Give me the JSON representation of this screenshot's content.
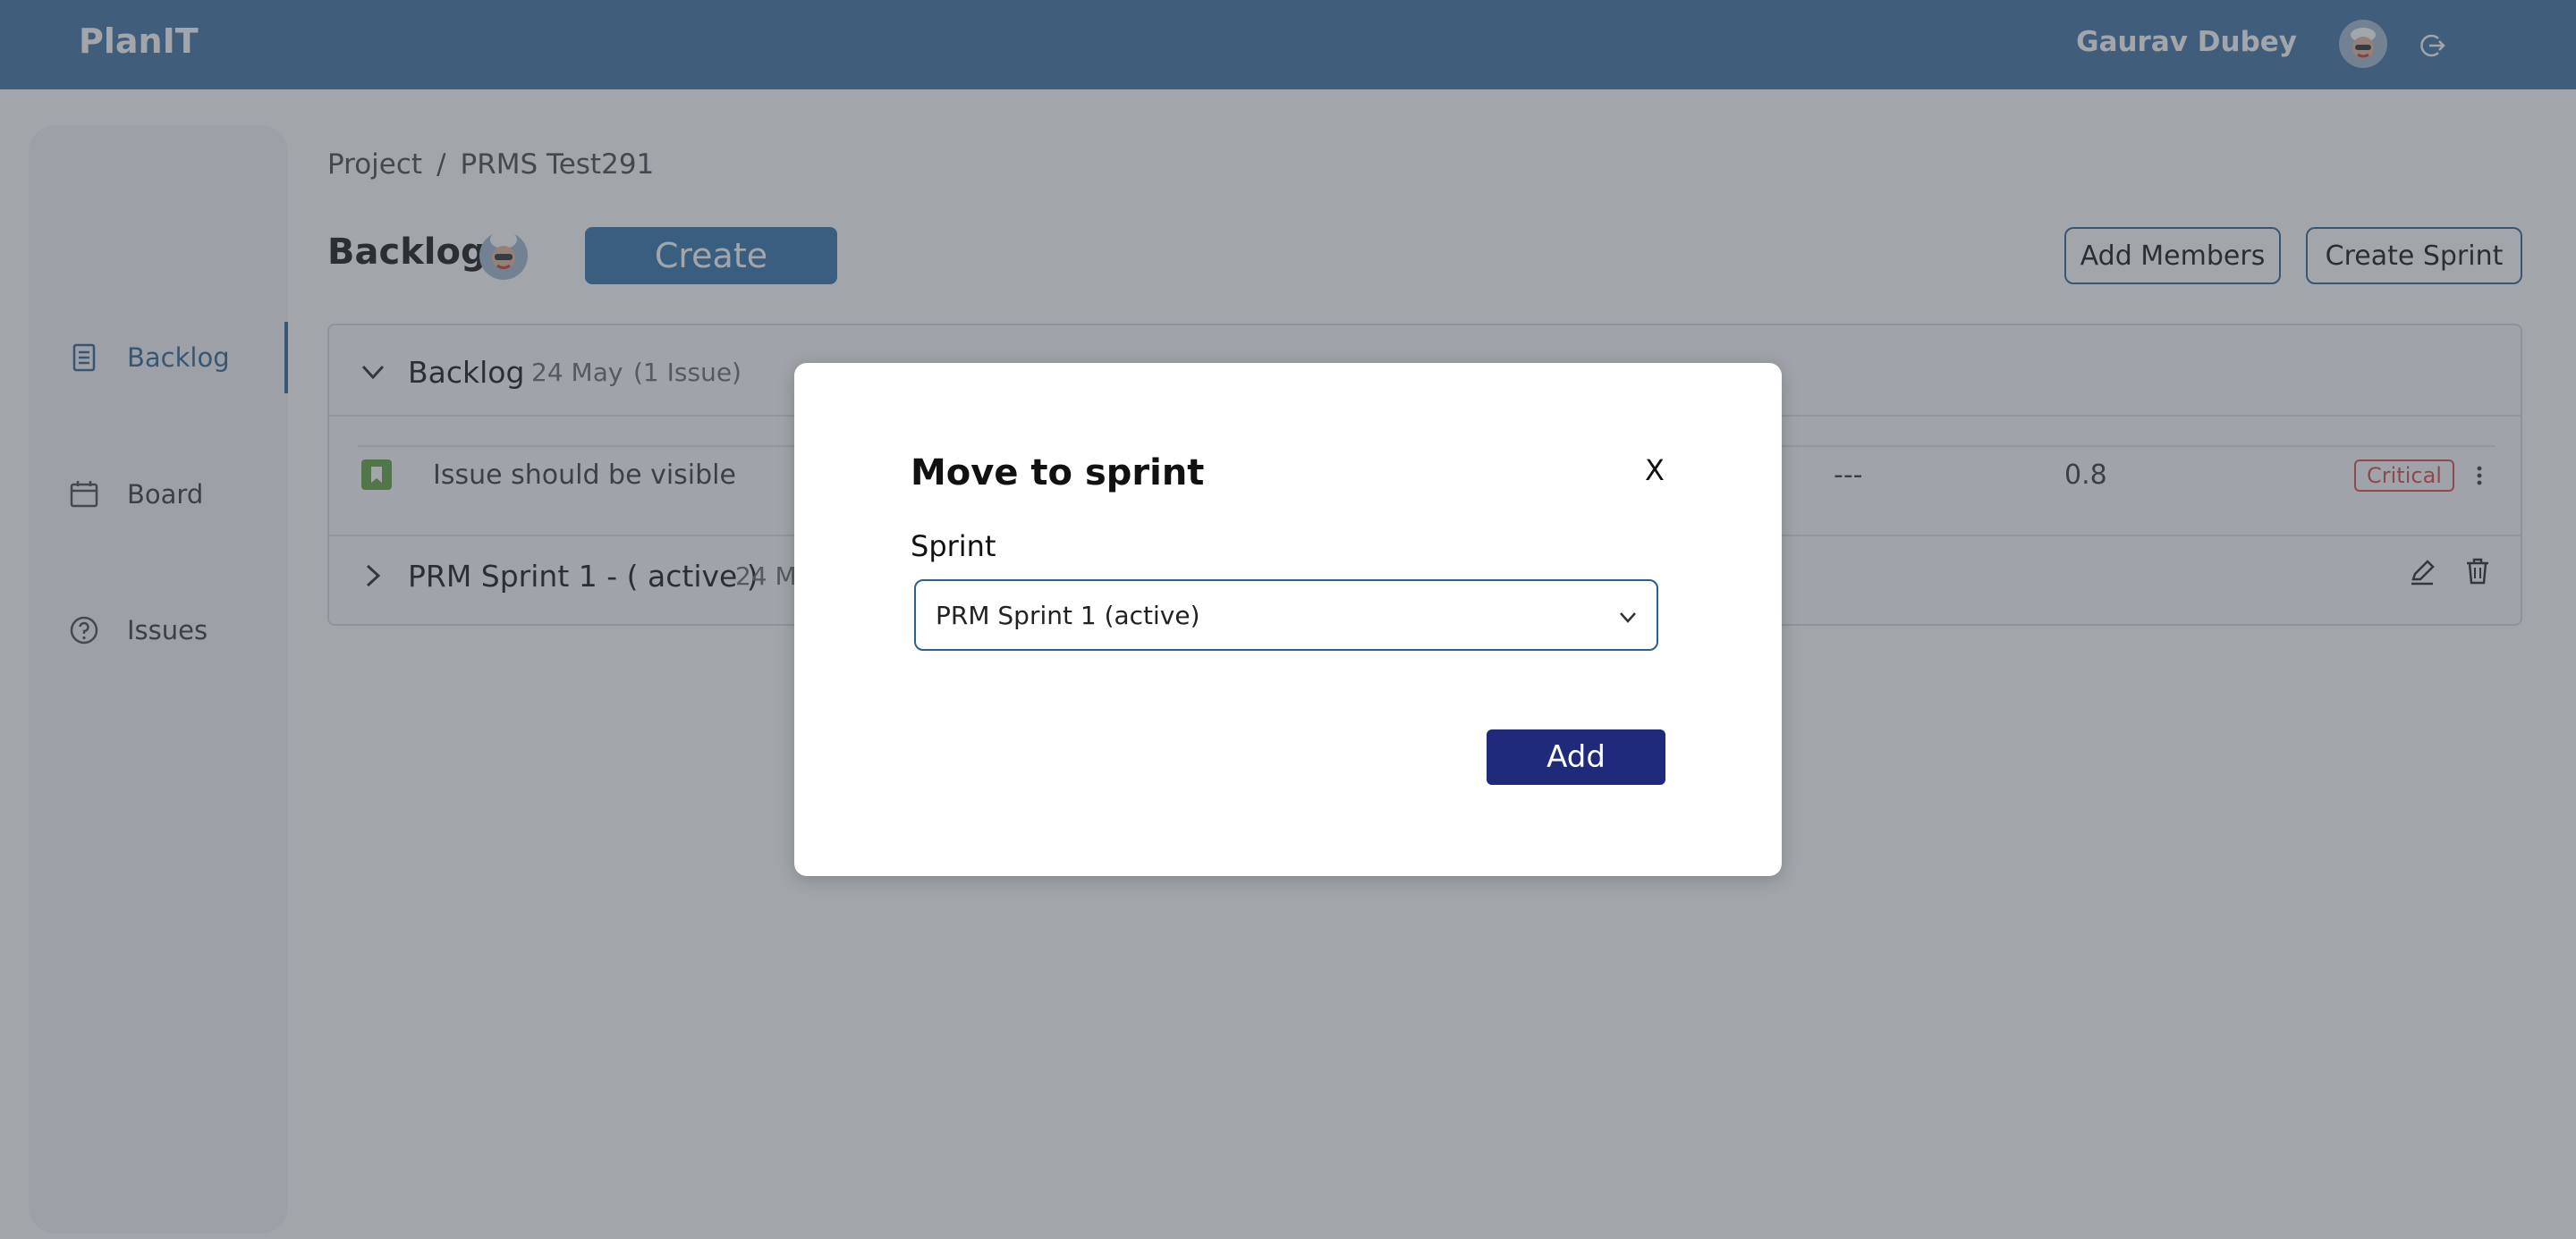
{
  "app": {
    "name": "PlanIT"
  },
  "user": {
    "name": "Gaurav Dubey"
  },
  "sidebar": {
    "items": [
      {
        "label": "Backlog",
        "icon": "list-icon"
      },
      {
        "label": "Board",
        "icon": "calendar-icon"
      },
      {
        "label": "Issues",
        "icon": "help-circle-icon"
      }
    ]
  },
  "breadcrumb": {
    "root": "Project",
    "separator": "/",
    "current": "PRMS Test291"
  },
  "page": {
    "title": "Backlog",
    "create_label": "Create",
    "add_members_label": "Add Members",
    "create_sprint_label": "Create Sprint"
  },
  "backlog_section": {
    "title": "Backlog",
    "date": "24 May",
    "count": "(1 Issue)",
    "issues": [
      {
        "title": "Issue should be visible",
        "assignee": "---",
        "points": "0.8",
        "priority": "Critical"
      }
    ]
  },
  "sprint_section": {
    "title": "PRM Sprint 1 - ( active )",
    "date": "24 M"
  },
  "modal": {
    "title": "Move to sprint",
    "close_label": "X",
    "field_label": "Sprint",
    "selected_sprint": "PRM Sprint 1 (active)",
    "submit_label": "Add"
  },
  "colors": {
    "topbar": "#3a6d9e",
    "primary": "#2f6fa8",
    "modal_button": "#1f2a7a",
    "critical": "#d94545"
  }
}
